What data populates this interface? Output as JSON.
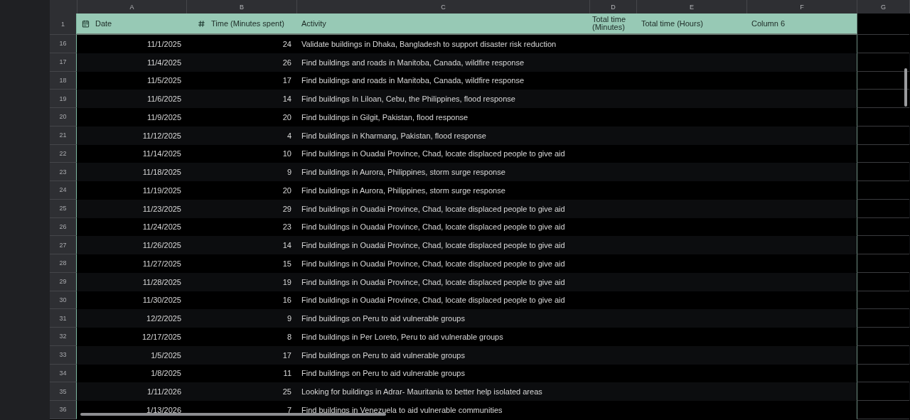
{
  "column_letters": [
    "A",
    "B",
    "C",
    "D",
    "E",
    "F",
    "G"
  ],
  "header_row": {
    "number": "1",
    "cells": [
      {
        "label": "Date",
        "kind": "date"
      },
      {
        "label": "Time (Minutes spent)",
        "kind": "number"
      },
      {
        "label": "Activity",
        "kind": "text"
      },
      {
        "label": "Total time (Minutes)",
        "kind": "text"
      },
      {
        "label": "Total time (Hours)",
        "kind": "text"
      },
      {
        "label": "Column 6",
        "kind": "text"
      }
    ]
  },
  "rows": [
    {
      "number": "16",
      "date": "11/1/2025",
      "minutes": "24",
      "activity": "Validate buildings in Dhaka, Bangladesh to support disaster risk reduction"
    },
    {
      "number": "17",
      "date": "11/4/2025",
      "minutes": "26",
      "activity": "Find buildings and roads in Manitoba, Canada, wildfire response"
    },
    {
      "number": "18",
      "date": "11/5/2025",
      "minutes": "17",
      "activity": "Find buildings and roads in Manitoba, Canada, wildfire response"
    },
    {
      "number": "19",
      "date": "11/6/2025",
      "minutes": "14",
      "activity": "Find buildings In Liloan, Cebu, the Philippines, flood response"
    },
    {
      "number": "20",
      "date": "11/9/2025",
      "minutes": "20",
      "activity": "Find buildings in Gilgit, Pakistan, flood response"
    },
    {
      "number": "21",
      "date": "11/12/2025",
      "minutes": "4",
      "activity": "Find buildings in Kharmang, Pakistan, flood response"
    },
    {
      "number": "22",
      "date": "11/14/2025",
      "minutes": "10",
      "activity": "Find buildings in Ouadai Province, Chad,  locate displaced people to give aid"
    },
    {
      "number": "23",
      "date": "11/18/2025",
      "minutes": "9",
      "activity": "Find buildings in Aurora, Philippines, storm surge response"
    },
    {
      "number": "24",
      "date": "11/19/2025",
      "minutes": "20",
      "activity": "Find buildings in Aurora, Philippines, storm surge response"
    },
    {
      "number": "25",
      "date": "11/23/2025",
      "minutes": "29",
      "activity": "Find buildings in Ouadai Province, Chad, locate displaced people to give aid"
    },
    {
      "number": "26",
      "date": "11/24/2025",
      "minutes": "23",
      "activity": "Find buildings in Ouadai Province, Chad, locate displaced people to give aid"
    },
    {
      "number": "27",
      "date": "11/26/2025",
      "minutes": "14",
      "activity": "Find buildings in Ouadai Province, Chad, locate displaced people to give aid"
    },
    {
      "number": "28",
      "date": "11/27/2025",
      "minutes": "15",
      "activity": "Find buildings in Ouadai Province, Chad, locate displaced people to give aid"
    },
    {
      "number": "29",
      "date": "11/28/2025",
      "minutes": "19",
      "activity": "Find buildings in Ouadai Province, Chad, locate displaced people to give aid"
    },
    {
      "number": "30",
      "date": "11/30/2025",
      "minutes": "16",
      "activity": "Find buildings in Ouadai Province, Chad, locate displaced people to give aid"
    },
    {
      "number": "31",
      "date": "12/2/2025",
      "minutes": "9",
      "activity": "Find buildings on Peru to aid vulnerable groups"
    },
    {
      "number": "32",
      "date": "12/17/2025",
      "minutes": "8",
      "activity": "Find buildings in Per Loreto, Peru to aid vulnerable groups"
    },
    {
      "number": "33",
      "date": "1/5/2025",
      "minutes": "17",
      "activity": "Find buildings on Peru to aid vulnerable groups"
    },
    {
      "number": "34",
      "date": "1/8/2025",
      "minutes": "11",
      "activity": "Find buildings on Peru to aid vulnerable groups"
    },
    {
      "number": "35",
      "date": "1/11/2026",
      "minutes": "25",
      "activity": "Looking for buildings in Adrar- Mauritania to better help isolated areas"
    },
    {
      "number": "36",
      "date": "1/13/2026",
      "minutes": "7",
      "activity": "Find buildings in  Venezuela to aid vulnerable communities"
    }
  ]
}
